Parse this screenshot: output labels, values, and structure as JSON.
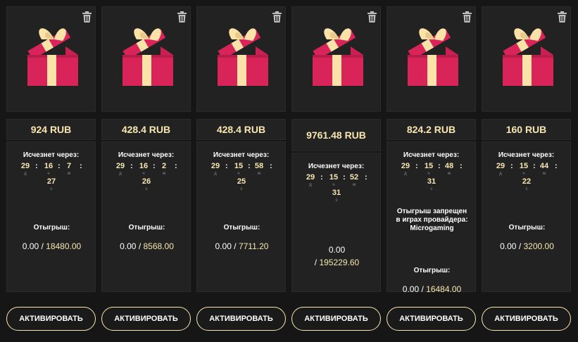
{
  "colors": {
    "background": "#161616",
    "card": "#222222",
    "accent": "#f8e6b0",
    "gift_box": "#d9245a",
    "gift_ribbon": "#fbe2a8"
  },
  "icons": {
    "delete": "trash-icon",
    "image": "gift-box-icon"
  },
  "cards": [
    {
      "amount": "924 RUB",
      "expires_label": "Исчезнет через:",
      "timer": {
        "days": "29",
        "hours": "16",
        "minutes": "7",
        "seconds": "27",
        "sep": ":",
        "u_d": "д",
        "u_h": "ч",
        "u_m": "м",
        "u_s": "с"
      },
      "restriction": "",
      "wager_label": "Отыгрыш:",
      "wager_current": "0.00",
      "wager_slash": "/",
      "wager_required": "18480.00",
      "button": "АКТИВИРОВАТЬ"
    },
    {
      "amount": "428.4 RUB",
      "expires_label": "Исчезнет через:",
      "timer": {
        "days": "29",
        "hours": "16",
        "minutes": "2",
        "seconds": "26",
        "sep": ":",
        "u_d": "д",
        "u_h": "ч",
        "u_m": "м",
        "u_s": "с"
      },
      "restriction": "",
      "wager_label": "Отыгрыш:",
      "wager_current": "0.00",
      "wager_slash": "/",
      "wager_required": "8568.00",
      "button": "АКТИВИРОВАТЬ"
    },
    {
      "amount": "428.4 RUB",
      "expires_label": "Исчезнет через:",
      "timer": {
        "days": "29",
        "hours": "15",
        "minutes": "58",
        "seconds": "25",
        "sep": ":",
        "u_d": "д",
        "u_h": "ч",
        "u_m": "м",
        "u_s": "с"
      },
      "restriction": "",
      "wager_label": "Отыгрыш:",
      "wager_current": "0.00",
      "wager_slash": "/",
      "wager_required": "7711.20",
      "button": "АКТИВИРОВАТЬ"
    },
    {
      "amount": "9761.48 RUB",
      "expires_label": "Исчезнет через:",
      "timer": {
        "days": "29",
        "hours": "15",
        "minutes": "52",
        "seconds": "31",
        "sep": ":",
        "u_d": "д",
        "u_h": "ч",
        "u_m": "м",
        "u_s": "с"
      },
      "restriction": "",
      "wager_label": "",
      "wager_current": "0.00",
      "wager_slash": "/",
      "wager_required": "195229.60",
      "button": "АКТИВИРОВАТЬ"
    },
    {
      "amount": "824.2 RUB",
      "expires_label": "Исчезнет через:",
      "timer": {
        "days": "29",
        "hours": "15",
        "minutes": "48",
        "seconds": "31",
        "sep": ":",
        "u_d": "д",
        "u_h": "ч",
        "u_m": "м",
        "u_s": "с"
      },
      "restriction": "Отыгрыш запрещен в играх провайдера: Microgaming",
      "wager_label": "Отыгрыш:",
      "wager_current": "0.00",
      "wager_slash": "/",
      "wager_required": "16484.00",
      "button": "АКТИВИРОВАТЬ"
    },
    {
      "amount": "160 RUB",
      "expires_label": "Исчезнет через:",
      "timer": {
        "days": "29",
        "hours": "15",
        "minutes": "44",
        "seconds": "22",
        "sep": ":",
        "u_d": "д",
        "u_h": "ч",
        "u_m": "м",
        "u_s": "с"
      },
      "restriction": "",
      "wager_label": "Отыгрыш:",
      "wager_current": "0.00",
      "wager_slash": "/",
      "wager_required": "3200.00",
      "button": "АКТИВИРОВАТЬ"
    }
  ]
}
